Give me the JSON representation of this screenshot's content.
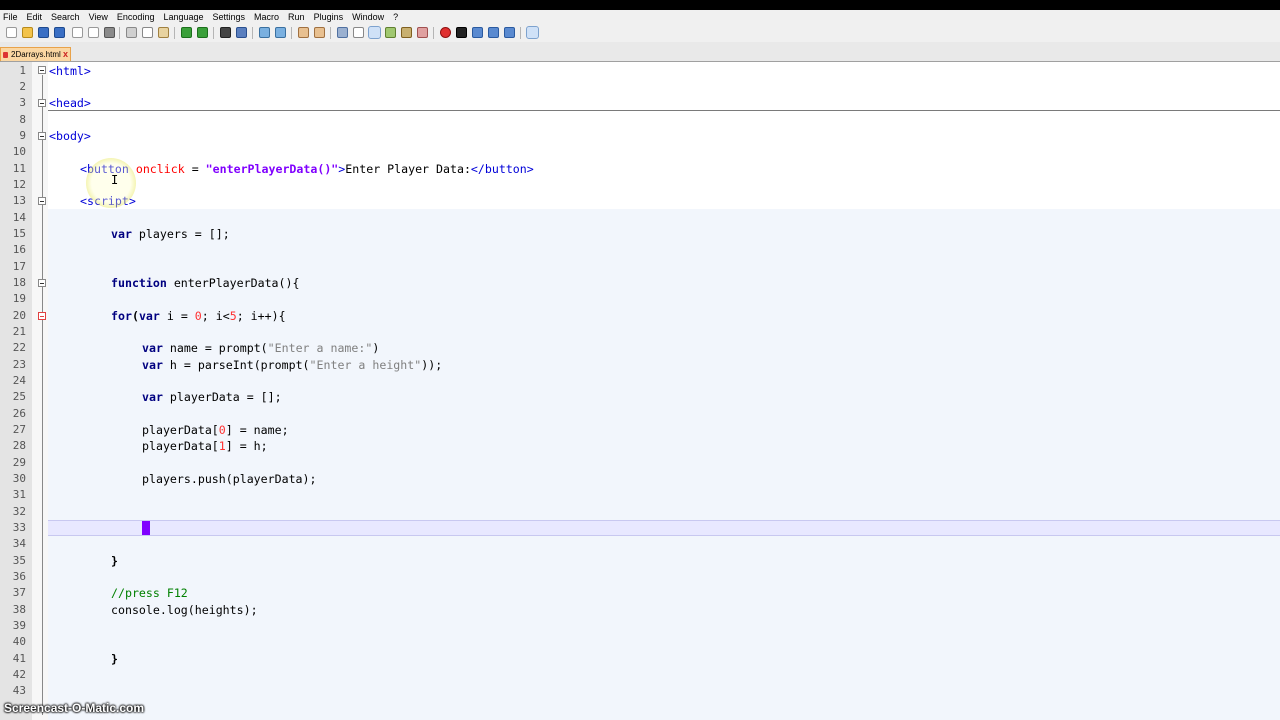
{
  "menu": [
    "File",
    "Edit",
    "Search",
    "View",
    "Encoding",
    "Language",
    "Settings",
    "Macro",
    "Run",
    "Plugins",
    "Window",
    "?"
  ],
  "tab": {
    "filename": "2Darrays.html",
    "close": "x"
  },
  "toolbar_icons": [
    "new-file-icon",
    "open-file-icon",
    "save-icon",
    "save-all-icon",
    "close-icon",
    "close-all-icon",
    "print-icon",
    "cut-icon",
    "copy-icon",
    "paste-icon",
    "undo-icon",
    "redo-icon",
    "find-icon",
    "replace-icon",
    "zoom-in-icon",
    "zoom-out-icon",
    "sync-vertical-icon",
    "sync-horizontal-icon",
    "word-wrap-icon",
    "show-all-chars-icon",
    "indent-guide-icon",
    "folder-as-workspace-icon",
    "document-map-icon",
    "function-list-icon",
    "record-macro-icon",
    "stop-record-icon",
    "play-macro-icon",
    "play-multiple-icon",
    "save-macro-icon",
    "spell-check-icon"
  ],
  "line_numbers": [
    "1",
    "2",
    "3",
    "8",
    "9",
    "10",
    "11",
    "12",
    "13",
    "14",
    "15",
    "16",
    "17",
    "18",
    "19",
    "20",
    "21",
    "22",
    "23",
    "24",
    "25",
    "26",
    "27",
    "28",
    "29",
    "30",
    "31",
    "32",
    "33",
    "34",
    "35",
    "36",
    "37",
    "38",
    "39",
    "40",
    "41",
    "42",
    "43"
  ],
  "code": {
    "l1": "<html>",
    "l3": "<head>",
    "l9": "<body>",
    "l11_tag_open": "<button ",
    "l11_attr": "onclick",
    "l11_eq": " = ",
    "l11_str": "\"enterPlayerData()\"",
    "l11_gt": ">",
    "l11_text": "Enter Player Data:",
    "l11_close": "</button>",
    "l13": "<script>",
    "l15_kw": "var",
    "l15_rest": " players = [];",
    "l18_kw": "function",
    "l18_rest": " enterPlayerData(){",
    "l20_for": "for",
    "l20_p1": "(",
    "l20_var": "var",
    "l20_p2": " i = ",
    "l20_n0": "0",
    "l20_p3": "; i<",
    "l20_n5": "5",
    "l20_p4": "; i++){",
    "l22_kw": "var",
    "l22_a": " name = prompt(",
    "l22_s": "\"Enter a name:\"",
    "l22_b": ")",
    "l23_kw": "var",
    "l23_a": " h = parseInt(prompt(",
    "l23_s": "\"Enter a height\"",
    "l23_b": "));",
    "l25_kw": "var",
    "l25_rest": " playerData = [];",
    "l27_a": "playerData[",
    "l27_n": "0",
    "l27_b": "] = name;",
    "l28_a": "playerData[",
    "l28_n": "1",
    "l28_b": "] = h;",
    "l30": "players.push(playerData);",
    "l35": "}",
    "l37": "//press F12",
    "l38": "console.log(heights);",
    "l41": "}"
  },
  "watermark": "Screencast-O-Matic.com",
  "colors": {
    "tag": "#0000d8",
    "attr": "#ff0000",
    "string": "#8000ff",
    "keyword": "#000080",
    "comment": "#008000",
    "caret": "#8000ff"
  }
}
